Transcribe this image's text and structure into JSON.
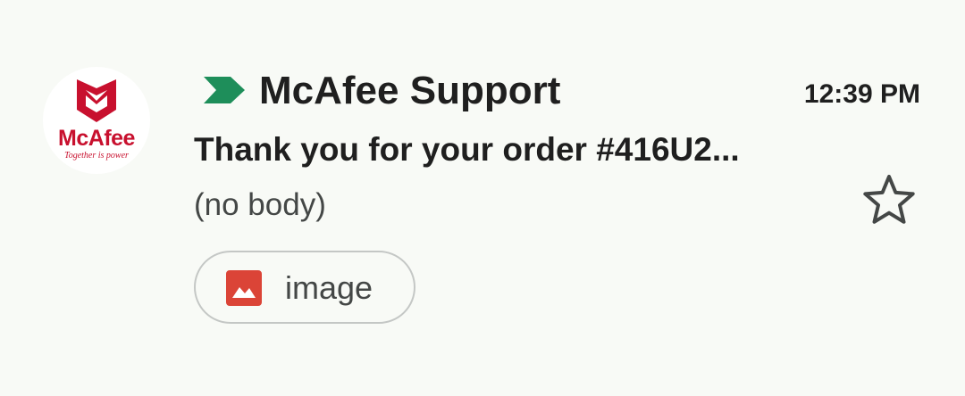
{
  "email_item": {
    "avatar": {
      "brand_name": "McAfee",
      "tagline": "Together is power"
    },
    "important_marker": "important-icon",
    "sender": "McAfee Support",
    "time": "12:39 PM",
    "subject": "Thank you for your order #416U2...",
    "snippet": "(no body)",
    "starred": false,
    "attachment": {
      "type_icon": "image-icon",
      "label": "image"
    }
  },
  "colors": {
    "background": "#f8faf6",
    "important_marker": "#1e8e5a",
    "brand_red": "#c8102e",
    "attachment_icon": "#db4437",
    "text_primary": "#1f1f1f",
    "text_secondary": "#444746"
  }
}
